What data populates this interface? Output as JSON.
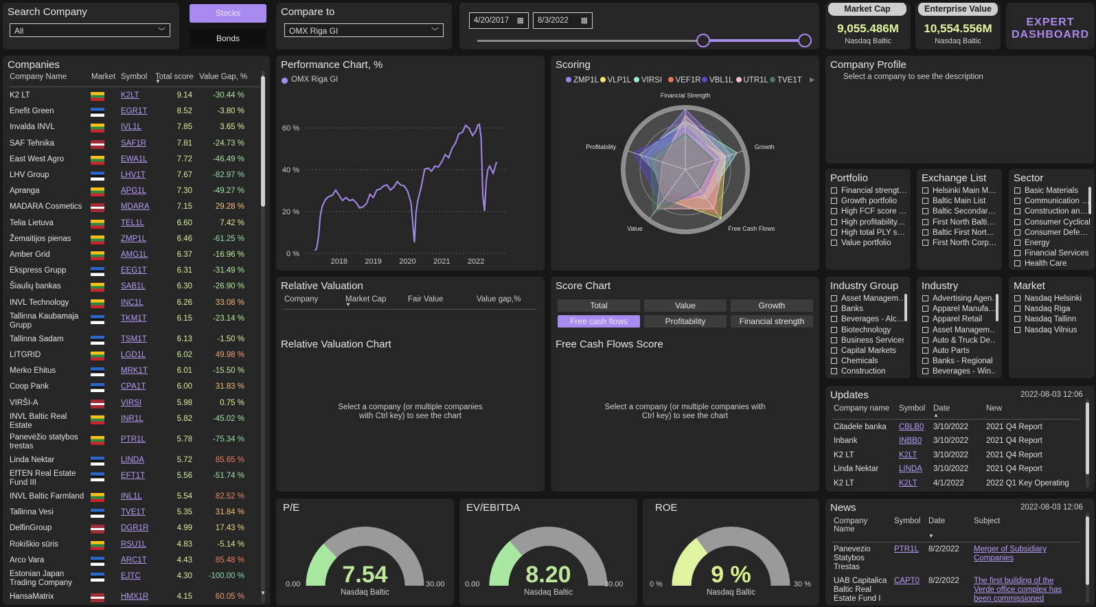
{
  "search_company": {
    "title": "Search Company",
    "value": "All"
  },
  "type_toggle": {
    "stocks": "Stocks",
    "bonds": "Bonds"
  },
  "compare": {
    "title": "Compare to",
    "value": "OMX Riga GI"
  },
  "dates": {
    "start": "4/20/2017",
    "end": "8/3/2022"
  },
  "kpis": {
    "market_cap": {
      "label": "Market Cap",
      "value": "9,055.486M",
      "sub": "Nasdaq Baltic"
    },
    "enterprise_value": {
      "label": "Enterprise Value",
      "value": "10,554.556M",
      "sub": "Nasdaq Baltic"
    }
  },
  "expert_button": {
    "line1": "EXPERT",
    "line2": "DASHBOARD"
  },
  "companies": {
    "title": "Companies",
    "headers": [
      "Company Name",
      "Market",
      "Symbol",
      "Total score",
      "Value Gap, %"
    ],
    "rows": [
      {
        "name": "K2 LT",
        "flag": "LT",
        "symbol": "K2LT",
        "score": "9.14",
        "gap": "-30.44 %",
        "gap_color": "#a8e6a0"
      },
      {
        "name": "Enefit Green",
        "flag": "EE",
        "symbol": "EGR1T",
        "score": "8.52",
        "gap": "-3.80 %",
        "gap_color": "#d8ef9a"
      },
      {
        "name": "Invalda INVL",
        "flag": "LT",
        "symbol": "IVL1L",
        "score": "7.85",
        "gap": "3.65 %",
        "gap_color": "#e9ee92"
      },
      {
        "name": "SAF Tehnika",
        "flag": "LV",
        "symbol": "SAF1R",
        "score": "7.81",
        "gap": "-24.73 %",
        "gap_color": "#b7e99c"
      },
      {
        "name": "East West Agro",
        "flag": "LT",
        "symbol": "EWA1L",
        "score": "7.72",
        "gap": "-46.49 %",
        "gap_color": "#9fe2a2"
      },
      {
        "name": "LHV Group",
        "flag": "EE",
        "symbol": "LHV1T",
        "score": "7.67",
        "gap": "-82.97 %",
        "gap_color": "#8fdcae"
      },
      {
        "name": "Apranga",
        "flag": "LT",
        "symbol": "APG1L",
        "score": "7.30",
        "gap": "-49.27 %",
        "gap_color": "#9de1a4"
      },
      {
        "name": "MADARA Cosmetics",
        "flag": "LV",
        "symbol": "MDARA",
        "score": "7.15",
        "gap": "29.28 %",
        "gap_color": "#f2c27a"
      },
      {
        "name": "Telia Lietuva",
        "flag": "LT",
        "symbol": "TEL1L",
        "score": "6.60",
        "gap": "7.42 %",
        "gap_color": "#ece98e"
      },
      {
        "name": "Žemaitijos pienas",
        "flag": "LT",
        "symbol": "ZMP1L",
        "score": "6.46",
        "gap": "-61.25 %",
        "gap_color": "#96dea8"
      },
      {
        "name": "Amber Grid",
        "flag": "LT",
        "symbol": "AMG1L",
        "score": "6.37",
        "gap": "-16.96 %",
        "gap_color": "#c3eb9a"
      },
      {
        "name": "Ekspress Grupp",
        "flag": "EE",
        "symbol": "EEG1T",
        "score": "6.31",
        "gap": "-31.49 %",
        "gap_color": "#ade79e"
      },
      {
        "name": "Šiaulių bankas",
        "flag": "LT",
        "symbol": "SAB1L",
        "score": "6.30",
        "gap": "-26.90 %",
        "gap_color": "#b4e89c"
      },
      {
        "name": "INVL Technology",
        "flag": "LT",
        "symbol": "INC1L",
        "score": "6.26",
        "gap": "33.08 %",
        "gap_color": "#f1bb78"
      },
      {
        "name": "Tallinna Kaubamaja Grupp",
        "flag": "EE",
        "symbol": "TKM1T",
        "score": "6.15",
        "gap": "-23.14 %",
        "gap_color": "#b9e99b"
      },
      {
        "name": "Tallinna Sadam",
        "flag": "EE",
        "symbol": "TSM1T",
        "score": "6.13",
        "gap": "-1.50 %",
        "gap_color": "#dcef98"
      },
      {
        "name": "LITGRID",
        "flag": "LT",
        "symbol": "LGD1L",
        "score": "6.02",
        "gap": "49.98 %",
        "gap_color": "#f0a070"
      },
      {
        "name": "Merko Ehitus",
        "flag": "EE",
        "symbol": "MRK1T",
        "score": "6.01",
        "gap": "-15.50 %",
        "gap_color": "#c5eb99"
      },
      {
        "name": "Coop Pank",
        "flag": "EE",
        "symbol": "CPA1T",
        "score": "6.00",
        "gap": "31.83 %",
        "gap_color": "#f1bd79"
      },
      {
        "name": "VIRŠI-A",
        "flag": "LV",
        "symbol": "VIRSI",
        "score": "5.98",
        "gap": "0.75 %",
        "gap_color": "#e6ee93"
      },
      {
        "name": "INVL Baltic Real Estate",
        "flag": "LT",
        "symbol": "INR1L",
        "score": "5.82",
        "gap": "-45.02 %",
        "gap_color": "#a0e2a2"
      },
      {
        "name": "Panevėžio statybos trestas",
        "flag": "LT",
        "symbol": "PTR1L",
        "score": "5.78",
        "gap": "-75.34 %",
        "gap_color": "#90ddad"
      },
      {
        "name": "Linda Nektar",
        "flag": "EE",
        "symbol": "LINDA",
        "score": "5.72",
        "gap": "85.65 %",
        "gap_color": "#ef7f66"
      },
      {
        "name": "EfTEN Real Estate Fund III",
        "flag": "EE",
        "symbol": "EFT1T",
        "score": "5.56",
        "gap": "-51.74 %",
        "gap_color": "#9be0a5"
      },
      {
        "name": "INVL Baltic Farmland",
        "flag": "LT",
        "symbol": "INL1L",
        "score": "5.54",
        "gap": "82.52 %",
        "gap_color": "#ef8467"
      },
      {
        "name": "Tallinna Vesi",
        "flag": "EE",
        "symbol": "TVE1T",
        "score": "5.35",
        "gap": "31.84 %",
        "gap_color": "#f1bd79"
      },
      {
        "name": "DelfinGroup",
        "flag": "LV",
        "symbol": "DGR1R",
        "score": "4.99",
        "gap": "17.43 %",
        "gap_color": "#f0d685"
      },
      {
        "name": "Rokiškio sūris",
        "flag": "LT",
        "symbol": "RSU1L",
        "score": "4.83",
        "gap": "-5.14 %",
        "gap_color": "#d5ee99"
      },
      {
        "name": "Arco Vara",
        "flag": "EE",
        "symbol": "ARC1T",
        "score": "4.43",
        "gap": "85.48 %",
        "gap_color": "#ef7f66"
      },
      {
        "name": "Estonian Japan Trading Company",
        "flag": "EE",
        "symbol": "EJTC",
        "score": "4.30",
        "gap": "-100.00 %",
        "gap_color": "#8ad9b2"
      },
      {
        "name": "HansaMatrix",
        "flag": "LV",
        "symbol": "HMX1R",
        "score": "4.15",
        "gap": "60.05 %",
        "gap_color": "#f09a6c"
      }
    ]
  },
  "performance": {
    "title": "Performance Chart, %",
    "legend": "OMX Riga GI"
  },
  "chart_data": [
    {
      "type": "line",
      "title": "Performance Chart, %",
      "series": [
        {
          "name": "OMX Riga GI",
          "color": "#a98af0",
          "x": [
            2017.3,
            2017.35,
            2017.4,
            2017.45,
            2017.5,
            2017.6,
            2017.7,
            2017.8,
            2017.9,
            2018.0,
            2018.1,
            2018.2,
            2018.3,
            2018.4,
            2018.5,
            2018.6,
            2018.7,
            2018.8,
            2018.9,
            2019.0,
            2019.1,
            2019.2,
            2019.3,
            2019.4,
            2019.5,
            2019.6,
            2019.7,
            2019.8,
            2019.9,
            2020.0,
            2020.1,
            2020.15,
            2020.2,
            2020.25,
            2020.3,
            2020.4,
            2020.5,
            2020.6,
            2020.7,
            2020.8,
            2020.9,
            2021.0,
            2021.1,
            2021.2,
            2021.3,
            2021.4,
            2021.5,
            2021.6,
            2021.7,
            2021.8,
            2021.9,
            2022.0,
            2022.05,
            2022.1,
            2022.15,
            2022.2,
            2022.25,
            2022.3,
            2022.35,
            2022.4,
            2022.5,
            2022.6
          ],
          "y": [
            1,
            3,
            8,
            18,
            22,
            26,
            27,
            28,
            30,
            28,
            25,
            27,
            25,
            26,
            24,
            22,
            22,
            24,
            28,
            27,
            30,
            31,
            32,
            33,
            30,
            32,
            34,
            33,
            32,
            30,
            24,
            15,
            5,
            20,
            25,
            32,
            40,
            41,
            39,
            42,
            41,
            44,
            47,
            46,
            50,
            53,
            57,
            58,
            61,
            60,
            56,
            59,
            61,
            62,
            55,
            28,
            20,
            35,
            40,
            42,
            38,
            44
          ]
        }
      ],
      "xticks": [
        "2018",
        "2019",
        "2020",
        "2021",
        "2022"
      ],
      "yticks": [
        "0 %",
        "20 %",
        "40 %",
        "60 %"
      ],
      "ylim": [
        0,
        65
      ],
      "xlim": [
        2017.0,
        2022.9
      ]
    },
    {
      "type": "radar",
      "title": "Scoring",
      "axes": [
        "Financial Strength",
        "Growth",
        "Free Cash Flows",
        "Value",
        "Profitability"
      ],
      "rlim": [
        0,
        10
      ],
      "series": [
        {
          "name": "ZMP1L",
          "color": "#9f86f0",
          "values": [
            10,
            8,
            6,
            5,
            7
          ]
        },
        {
          "name": "VLP1L",
          "color": "#f5e36a",
          "values": [
            6,
            7,
            10,
            6,
            6
          ]
        },
        {
          "name": "VIRSI",
          "color": "#9ee8d3",
          "values": [
            8,
            9,
            6,
            4,
            8
          ]
        },
        {
          "name": "VEF1R",
          "color": "#e8735e",
          "values": [
            5,
            5,
            9,
            6,
            5
          ]
        },
        {
          "name": "VBL1L",
          "color": "#5a4ad0",
          "values": [
            7,
            6,
            5,
            7,
            9
          ]
        },
        {
          "name": "UTR1L",
          "color": "#f6b8d8",
          "values": [
            9,
            7,
            8,
            8,
            4
          ]
        },
        {
          "name": "TVE1T",
          "color": "#4a7a62",
          "values": [
            6,
            5,
            4,
            9,
            6
          ]
        }
      ]
    },
    {
      "type": "gauge",
      "title": "P/E",
      "value": 7.54,
      "min": 0,
      "max": 30,
      "display": "7.54",
      "min_label": "0.00",
      "max_label": "30.00",
      "sub": "Nasdaq Baltic"
    },
    {
      "type": "gauge",
      "title": "EV/EBITDA",
      "value": 8.2,
      "min": 0,
      "max": 30,
      "display": "8.20",
      "min_label": "0.00",
      "max_label": "30.00",
      "sub": "Nasdaq Baltic"
    },
    {
      "type": "gauge",
      "title": "ROE",
      "value": 9,
      "min": 0,
      "max": 30,
      "display": "9 %",
      "min_label": "0 %",
      "max_label": "30 %",
      "sub": "Nasdaq Baltic"
    }
  ],
  "scoring": {
    "title": "Scoring"
  },
  "company_profile": {
    "title": "Company Profile",
    "hint": "Select a company to see the description"
  },
  "portfolio": {
    "title": "Portfolio",
    "items": [
      "Financial strengt…",
      "Growth portfolio",
      "High FCF score …",
      "High profitability…",
      "High total PLY s…",
      "Value portfolio"
    ]
  },
  "exchange_list": {
    "title": "Exchange List",
    "items": [
      "Helsinki Main M…",
      "Baltic Main List",
      "Baltic Secondar…",
      "First North Balti…",
      "Baltic First Nort…",
      "First North Corp…"
    ]
  },
  "sector": {
    "title": "Sector",
    "items": [
      "Basic Materials",
      "Communication …",
      "Construction an…",
      "Consumer Cyclical",
      "Consumer Defe…",
      "Energy",
      "Financial Services",
      "Health Care"
    ]
  },
  "relative_valuation": {
    "title": "Relative Valuation",
    "headers": [
      "Company",
      "Market Cap",
      "Fair Value",
      "Value gap,%"
    ],
    "chart_title": "Relative Valuation Chart",
    "hint1": "Select a company (or multiple companies",
    "hint2": "with Ctrl key) to see the chart"
  },
  "score_chart": {
    "title": "Score Chart",
    "buttons": [
      "Total",
      "Value",
      "Growth",
      "Free cash flows",
      "Profitability",
      "Financial strength"
    ],
    "subtitle": "Free Cash Flows Score",
    "hint1": "Select a company (or multiple companies with",
    "hint2": "Ctrl key) to see the chart"
  },
  "industry_group": {
    "title": "Industry Group",
    "items": [
      "Asset Managem…",
      "Banks",
      "Beverages - Alc…",
      "Biotechnology",
      "Business Services",
      "Capital Markets",
      "Chemicals",
      "Construction"
    ]
  },
  "industry": {
    "title": "Industry",
    "items": [
      "Advertising Agen…",
      "Apparel Manufa…",
      "Apparel Retail",
      "Asset Managem…",
      "Auto & Truck De…",
      "Auto Parts",
      "Banks - Regional",
      "Beverages - Win…"
    ]
  },
  "market": {
    "title": "Market",
    "items": [
      "Nasdaq Helsinki",
      "Nasdaq Riga",
      "Nasdaq Tallinn",
      "Nasdaq Vilnius"
    ]
  },
  "updates": {
    "title": "Updates",
    "date": "2022-08-03 12:06",
    "headers": [
      "Company name",
      "Symbol",
      "Date",
      "New"
    ],
    "rows": [
      {
        "company": "Citadele banka",
        "symbol": "CBLB0",
        "date": "3/10/2022",
        "new": "2021 Q4 Report"
      },
      {
        "company": "Inbank",
        "symbol": "INBB0",
        "date": "3/10/2022",
        "new": "2021 Q4 Report"
      },
      {
        "company": "K2 LT",
        "symbol": "K2LT",
        "date": "3/10/2022",
        "new": "2021 Q4 Report"
      },
      {
        "company": "Linda Nektar",
        "symbol": "LINDA",
        "date": "3/10/2022",
        "new": "2021 Q4 Report"
      },
      {
        "company": "K2 LT",
        "symbol": "K2LT",
        "date": "4/1/2022",
        "new": "2022 Q1 Key Operating"
      }
    ]
  },
  "news": {
    "title": "News",
    "date": "2022-08-03 12:06",
    "headers": [
      "Company Name",
      "Symbol",
      "Date",
      "Subject"
    ],
    "rows": [
      {
        "company": "Panevezio Statybos Trestas",
        "symbol": "PTR1L",
        "date": "8/2/2022",
        "subject": "Merger of Subsidiary Companies"
      },
      {
        "company": "UAB Capitalica Baltic Real Estate Fund I",
        "symbol": "CAPT0",
        "date": "8/2/2022",
        "subject": "The first building of the Verde office complex has been commissioned"
      }
    ]
  },
  "colors": {
    "accent": "#a98af0",
    "panel": "#262626",
    "background": "#161616",
    "kpi_value": "#e4f7a0"
  }
}
